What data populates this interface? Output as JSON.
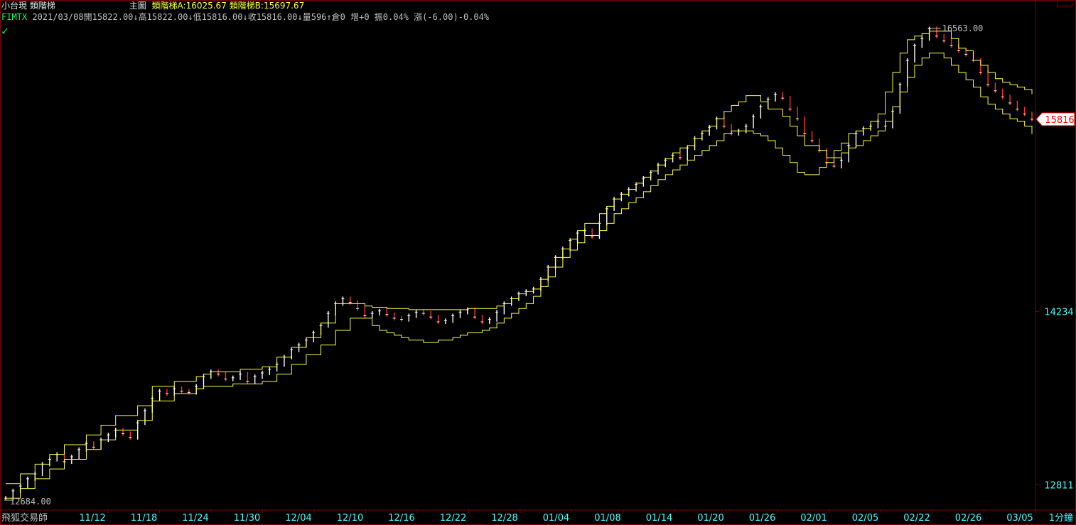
{
  "header": {
    "symbol_name": "小台現",
    "indicator_name": "類階梯",
    "pane_label": "主圖",
    "ind_a_label": "類階梯A:16025.67",
    "ind_b_label": "類階梯B:15697.67",
    "code": "FIMTX",
    "date": "2021/03/08",
    "open": "開15822.00↓",
    "high": "高15822.00↓",
    "low": "低15816.00↓",
    "close": "收15816.00↓",
    "volume": "量596↑",
    "oi": "倉0",
    "oi_change": "增+0",
    "amplitude": "振0.04%",
    "change": "漲(-6.00)-0.04%"
  },
  "footer": {
    "brand": "飛狐交易師",
    "interval": "1分鐘"
  },
  "colors": {
    "background": "#000000",
    "frame": "#800000",
    "ladder": "#ffff40",
    "candle_up": "#ffffff",
    "candle_down": "#ff3030",
    "axis_text": "#40ffff"
  },
  "chart_data": {
    "type": "line",
    "xlabel": "",
    "ylabel": "",
    "ylim": [
      12684,
      16563
    ],
    "x_ticks": [
      "11/12",
      "11/18",
      "11/24",
      "11/30",
      "12/04",
      "12/10",
      "12/16",
      "12/22",
      "12/28",
      "01/04",
      "01/08",
      "01/14",
      "01/20",
      "01/26",
      "02/01",
      "02/05",
      "02/22",
      "02/26",
      "03/05"
    ],
    "y_ticks": [
      12811,
      14234
    ],
    "last_price": 15816,
    "high_label": "16563.00",
    "low_label": "12684.00",
    "price_series": [
      12700,
      12760,
      12800,
      12860,
      12900,
      12980,
      13020,
      13060,
      13000,
      13040,
      13100,
      13150,
      13120,
      13180,
      13220,
      13260,
      13230,
      13200,
      13320,
      13420,
      13520,
      13580,
      13560,
      13600,
      13580,
      13570,
      13620,
      13700,
      13740,
      13720,
      13680,
      13690,
      13720,
      13660,
      13700,
      13730,
      13760,
      13800,
      13860,
      13920,
      13960,
      14000,
      14060,
      14120,
      14220,
      14300,
      14340,
      14310,
      14260,
      14200,
      14220,
      14240,
      14210,
      14180,
      14170,
      14200,
      14230,
      14220,
      14190,
      14150,
      14160,
      14200,
      14230,
      14250,
      14190,
      14150,
      14170,
      14230,
      14300,
      14340,
      14380,
      14400,
      14420,
      14500,
      14600,
      14680,
      14750,
      14820,
      14880,
      14900,
      14850,
      14960,
      15080,
      15160,
      15200,
      15240,
      15280,
      15330,
      15380,
      15440,
      15480,
      15520,
      15500,
      15580,
      15660,
      15700,
      15750,
      15820,
      15760,
      15700,
      15720,
      15760,
      15840,
      15920,
      15980,
      16020,
      15990,
      15900,
      15820,
      15700,
      15640,
      15560,
      15460,
      15430,
      15480,
      15600,
      15700,
      15740,
      15760,
      15800,
      15760,
      15880,
      16100,
      16300,
      16420,
      16480,
      16560,
      16500,
      16460,
      16420,
      16380,
      16350,
      16300,
      16200,
      16100,
      16050,
      16000,
      15950,
      15900,
      15860,
      15816
    ],
    "series": [
      {
        "name": "類階梯A",
        "values": [
          12820,
          12820,
          12900,
          12900,
          12980,
          12980,
          13060,
          13060,
          13140,
          13140,
          13140,
          13220,
          13220,
          13300,
          13300,
          13380,
          13380,
          13380,
          13460,
          13460,
          13620,
          13620,
          13620,
          13660,
          13660,
          13660,
          13700,
          13720,
          13740,
          13740,
          13740,
          13740,
          13760,
          13760,
          13760,
          13780,
          13780,
          13860,
          13860,
          13940,
          13940,
          14020,
          14020,
          14140,
          14140,
          14300,
          14300,
          14300,
          14300,
          14280,
          14270,
          14270,
          14260,
          14260,
          14260,
          14250,
          14250,
          14250,
          14250,
          14250,
          14250,
          14250,
          14250,
          14260,
          14260,
          14260,
          14260,
          14280,
          14300,
          14340,
          14380,
          14400,
          14420,
          14500,
          14600,
          14680,
          14750,
          14830,
          14900,
          14960,
          14960,
          15040,
          15100,
          15160,
          15200,
          15240,
          15290,
          15340,
          15390,
          15440,
          15490,
          15540,
          15580,
          15600,
          15660,
          15720,
          15760,
          15820,
          15880,
          15930,
          15960,
          16010,
          16010,
          15960,
          15900,
          15900,
          15840,
          15760,
          15680,
          15600,
          15600,
          15560,
          15500,
          15560,
          15620,
          15700,
          15720,
          15740,
          15800,
          15860,
          16040,
          16200,
          16360,
          16470,
          16500,
          16520,
          16540,
          16540,
          16540,
          16480,
          16400,
          16380,
          16300,
          16260,
          16200,
          16150,
          16120,
          16100,
          16080,
          16060,
          16025.67
        ]
      },
      {
        "name": "類階梯B",
        "values": [
          12700,
          12700,
          12780,
          12780,
          12860,
          12860,
          12940,
          12940,
          13020,
          13020,
          13020,
          13100,
          13100,
          13180,
          13180,
          13260,
          13260,
          13260,
          13340,
          13340,
          13500,
          13500,
          13500,
          13560,
          13560,
          13560,
          13600,
          13620,
          13620,
          13620,
          13620,
          13640,
          13640,
          13640,
          13640,
          13660,
          13660,
          13720,
          13720,
          13800,
          13800,
          13880,
          13880,
          13960,
          13960,
          14080,
          14080,
          14180,
          14180,
          14180,
          14120,
          14080,
          14060,
          14040,
          14020,
          14000,
          14000,
          13980,
          13980,
          14000,
          14000,
          14020,
          14040,
          14060,
          14060,
          14080,
          14100,
          14140,
          14180,
          14220,
          14260,
          14300,
          14360,
          14440,
          14520,
          14600,
          14680,
          14740,
          14800,
          14860,
          14860,
          14900,
          14960,
          15040,
          15080,
          15130,
          15170,
          15220,
          15270,
          15320,
          15360,
          15400,
          15440,
          15480,
          15520,
          15560,
          15600,
          15640,
          15700,
          15720,
          15720,
          15720,
          15700,
          15680,
          15640,
          15580,
          15520,
          15460,
          15380,
          15360,
          15360,
          15420,
          15460,
          15500,
          15540,
          15580,
          15600,
          15640,
          15680,
          15720,
          15800,
          15920,
          16040,
          16160,
          16260,
          16320,
          16360,
          16360,
          16320,
          16260,
          16200,
          16140,
          16080,
          16000,
          15940,
          15900,
          15860,
          15820,
          15800,
          15760,
          15697.67
        ]
      }
    ]
  }
}
